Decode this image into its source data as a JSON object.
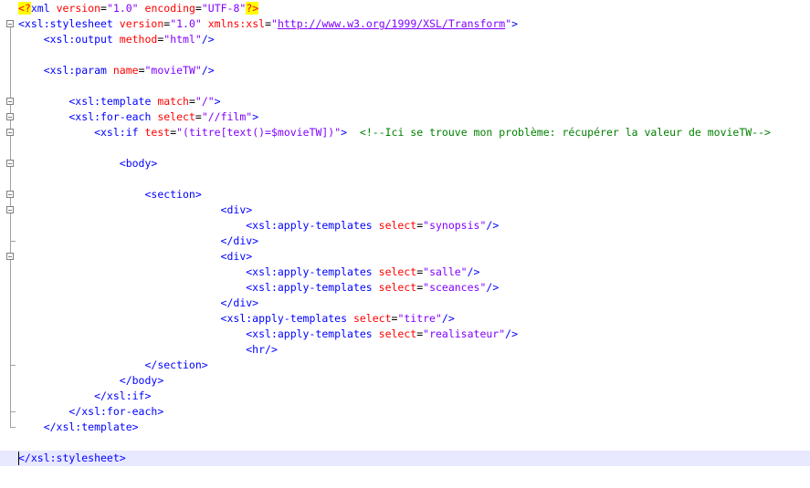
{
  "editor": {
    "lines": [
      {
        "segments": [
          [
            "pi",
            "<?"
          ],
          [
            "tag",
            "xml "
          ],
          [
            "attr",
            "version"
          ],
          [
            "punc",
            "="
          ],
          [
            "val",
            "\"1.0\""
          ],
          [
            "tag",
            " "
          ],
          [
            "attr",
            "encoding"
          ],
          [
            "punc",
            "="
          ],
          [
            "val",
            "\"UTF-8\""
          ],
          [
            "pi",
            "?>"
          ]
        ]
      },
      {
        "segments": [
          [
            "tag",
            "<xsl:stylesheet "
          ],
          [
            "attr",
            "version"
          ],
          [
            "punc",
            "="
          ],
          [
            "val",
            "\"1.0\""
          ],
          [
            "tag",
            " "
          ],
          [
            "attr",
            "xmlns:xsl"
          ],
          [
            "punc",
            "="
          ],
          [
            "val",
            "\""
          ],
          [
            "url",
            "http://www.w3.org/1999/XSL/Transform"
          ],
          [
            "val",
            "\""
          ],
          [
            "tag",
            ">"
          ]
        ]
      },
      {
        "segments": [
          [
            "tag",
            "    <xsl:output "
          ],
          [
            "attr",
            "method"
          ],
          [
            "punc",
            "="
          ],
          [
            "val",
            "\"html\""
          ],
          [
            "tag",
            "/>"
          ]
        ]
      },
      {
        "segments": []
      },
      {
        "segments": [
          [
            "tag",
            "    <xsl:param "
          ],
          [
            "attr",
            "name"
          ],
          [
            "punc",
            "="
          ],
          [
            "val",
            "\"movieTW\""
          ],
          [
            "tag",
            "/>"
          ]
        ]
      },
      {
        "segments": []
      },
      {
        "segments": [
          [
            "tag",
            "        <xsl:template "
          ],
          [
            "attr",
            "match"
          ],
          [
            "punc",
            "="
          ],
          [
            "val",
            "\"/\""
          ],
          [
            "tag",
            ">"
          ]
        ]
      },
      {
        "segments": [
          [
            "tag",
            "        <xsl:for-each "
          ],
          [
            "attr",
            "select"
          ],
          [
            "punc",
            "="
          ],
          [
            "val",
            "\"//film\""
          ],
          [
            "tag",
            ">"
          ]
        ]
      },
      {
        "segments": [
          [
            "tag",
            "            <xsl:if "
          ],
          [
            "attr",
            "test"
          ],
          [
            "punc",
            "="
          ],
          [
            "val",
            "\"(titre[text()=$movieTW])\""
          ],
          [
            "tag",
            ">  "
          ],
          [
            "comment",
            "<!--Ici se trouve mon problème: récupérer la valeur de movieTW-->"
          ]
        ]
      },
      {
        "segments": []
      },
      {
        "segments": [
          [
            "tag",
            "                <body>"
          ]
        ]
      },
      {
        "segments": []
      },
      {
        "segments": [
          [
            "tag",
            "                    <section>"
          ]
        ]
      },
      {
        "segments": [
          [
            "tag",
            "                                <div>"
          ]
        ]
      },
      {
        "segments": [
          [
            "tag",
            "                                    <xsl:apply-templates "
          ],
          [
            "attr",
            "select"
          ],
          [
            "punc",
            "="
          ],
          [
            "val",
            "\"synopsis\""
          ],
          [
            "tag",
            "/>"
          ]
        ]
      },
      {
        "segments": [
          [
            "tag",
            "                                </div>"
          ]
        ]
      },
      {
        "segments": [
          [
            "tag",
            "                                <div>"
          ]
        ]
      },
      {
        "segments": [
          [
            "tag",
            "                                    <xsl:apply-templates "
          ],
          [
            "attr",
            "select"
          ],
          [
            "punc",
            "="
          ],
          [
            "val",
            "\"salle\""
          ],
          [
            "tag",
            "/>"
          ]
        ]
      },
      {
        "segments": [
          [
            "tag",
            "                                    <xsl:apply-templates "
          ],
          [
            "attr",
            "select"
          ],
          [
            "punc",
            "="
          ],
          [
            "val",
            "\"sceances\""
          ],
          [
            "tag",
            "/>"
          ]
        ]
      },
      {
        "segments": [
          [
            "tag",
            "                                </div>"
          ]
        ]
      },
      {
        "segments": [
          [
            "tag",
            "                                <xsl:apply-templates "
          ],
          [
            "attr",
            "select"
          ],
          [
            "punc",
            "="
          ],
          [
            "val",
            "\"titre\""
          ],
          [
            "tag",
            "/>"
          ]
        ]
      },
      {
        "segments": [
          [
            "tag",
            "                                    <xsl:apply-templates "
          ],
          [
            "attr",
            "select"
          ],
          [
            "punc",
            "="
          ],
          [
            "val",
            "\"realisateur\""
          ],
          [
            "tag",
            "/>"
          ]
        ]
      },
      {
        "segments": [
          [
            "tag",
            "                                    <hr/>"
          ]
        ]
      },
      {
        "segments": [
          [
            "tag",
            "                    </section>"
          ]
        ]
      },
      {
        "segments": [
          [
            "tag",
            "                </body>"
          ]
        ]
      },
      {
        "segments": [
          [
            "tag",
            "            </xsl:if>"
          ]
        ]
      },
      {
        "segments": [
          [
            "tag",
            "        </xsl:for-each>"
          ]
        ]
      },
      {
        "segments": [
          [
            "tag",
            "    </xsl:template>"
          ]
        ]
      },
      {
        "segments": []
      },
      {
        "segments": [
          [
            "tag",
            "</xsl:stylesheet>"
          ]
        ]
      }
    ],
    "current_line": 29,
    "fold_markers": [
      1,
      6,
      7,
      8,
      10,
      12,
      13,
      16
    ],
    "fold_end_markers": [
      15,
      23,
      26,
      27
    ],
    "colors": {
      "tag": "#0000ff",
      "attribute": "#ff0000",
      "value": "#8000ff",
      "comment": "#008000",
      "processing_instruction_bg": "#ffff00",
      "current_line_bg": "#e8e8ff"
    }
  }
}
